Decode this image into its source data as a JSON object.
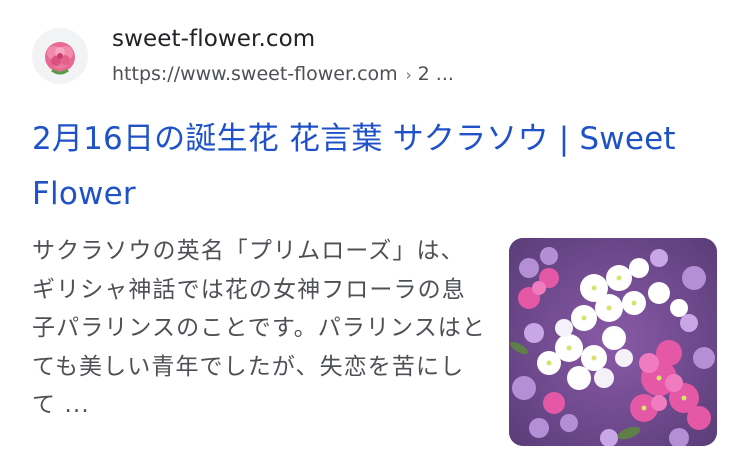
{
  "result": {
    "site_name": "sweet-flower.com",
    "url": "https://www.sweet-flower.com",
    "url_separator": "›",
    "breadcrumb_tail": "2 ...",
    "title": "2月16日の誕生花 花言葉 サクラソウ | Sweet Flower",
    "snippet": "サクラソウの英名「プリムローズ」は、ギリシャ神話では花の女神フローラの息子パラリンスのことです。パラリンスはとても美しい青年でしたが、失恋を苦にして ...",
    "favicon_icon": "pink-flower-icon",
    "thumbnail_icon": "primrose-flowers-photo"
  },
  "colors": {
    "title_link": "#1f52c8",
    "site_name": "#202124",
    "snippet_text": "#4d5156"
  }
}
